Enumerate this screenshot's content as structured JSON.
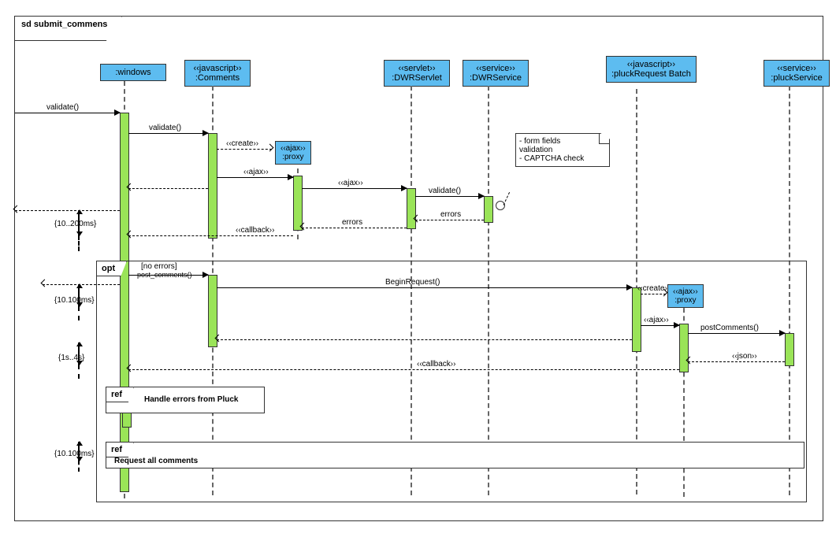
{
  "frame_title": "sd submit_commens",
  "lifelines": {
    "windows": ":windows",
    "comments_st": "‹‹javascript››",
    "comments": ":Comments",
    "dwrservlet_st": "‹‹servlet››",
    "dwrservlet": ":DWRServlet",
    "dwrservice_st": "‹‹service››",
    "dwrservice": ":DWRService",
    "pluckreq_st": "‹‹javascript››",
    "pluckreq": ":pluckRequest Batch",
    "pluckservice_st": "‹‹service››",
    "pluckservice": ":pluckService"
  },
  "proxy1_st": "‹‹ajax››",
  "proxy1": ":proxy",
  "proxy2_st": "‹‹ajax››",
  "proxy2": ":proxy",
  "msgs": {
    "validate1": "validate()",
    "validate2": "validate()",
    "create1": "‹‹create››",
    "ajax1": "‹‹ajax››",
    "ajax2": "‹‹ajax››",
    "validate3": "validate()",
    "errors1": "errors",
    "errors2": "errors",
    "callback1": "‹‹callback››",
    "opt": "opt",
    "guard": "[no errors]",
    "postc": "post_comments()",
    "begin": "BeginRequest()",
    "create2": "‹‹create››",
    "ajax3": "‹‹ajax››",
    "postcomm": "postComments()",
    "json": "‹‹json››",
    "callback2": "‹‹callback››"
  },
  "note": {
    "l1": "- form fields",
    "l2": "validation",
    "l3": "- CAPTCHA check"
  },
  "times": {
    "t1": "{10..200ms}",
    "t2": "{10.100ms}",
    "t3": "{1s..4s}",
    "t4": "{10.100ms}"
  },
  "refs": {
    "ref1": "ref",
    "ref1_text": "Handle errors from Pluck",
    "ref2": "ref",
    "ref2_text": "Request all comments"
  }
}
